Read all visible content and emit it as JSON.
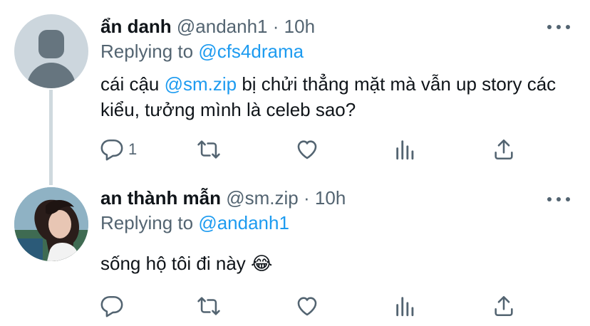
{
  "tweets": [
    {
      "name": "ẩn danh",
      "handle": "@andanh1",
      "separator": "·",
      "time": "10h",
      "replying_prefix": "Replying to",
      "replying_to": "@cfs4drama",
      "text_before": "cái cậu ",
      "mention": "@sm.zip",
      "text_after": " bị chửi thẳng mặt mà vẫn up story các kiểu, tưởng mình là celeb sao?",
      "reply_count": "1"
    },
    {
      "name": "an thành mẫn",
      "handle": "@sm.zip",
      "separator": "·",
      "time": "10h",
      "replying_prefix": "Replying to",
      "replying_to": "@andanh1",
      "text": "sống hộ tôi đi này 😂",
      "reply_count": ""
    }
  ],
  "colors": {
    "link": "#1d9bf0",
    "secondary_text": "#536471",
    "primary_text": "#0f1419",
    "thread_line": "#cfd9de"
  },
  "icons": [
    "more-icon",
    "reply-icon",
    "retweet-icon",
    "like-icon",
    "analytics-icon",
    "share-icon"
  ]
}
